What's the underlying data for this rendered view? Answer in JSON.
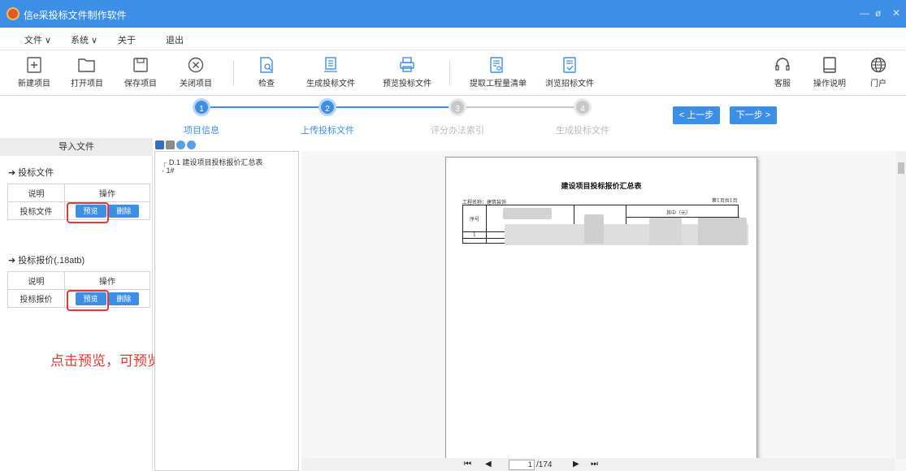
{
  "titlebar": {
    "title": "信e采投标文件制作软件",
    "minimize": "—",
    "restore": "ø",
    "close": "✕"
  },
  "menu": {
    "file": "文件 ∨",
    "system": "系统 ∨",
    "about": "关于",
    "exit": "退出"
  },
  "toolbar": {
    "new": "新建项目",
    "open": "打开项目",
    "save": "保存项目",
    "close": "关闭项目",
    "check": "检查",
    "generate": "生成投标文件",
    "preview": "预览投标文件",
    "extract": "提取工程量清单",
    "browse": "浏览招标文件",
    "service": "客服",
    "manual": "操作说明",
    "portal": "门户"
  },
  "steps": {
    "s1": {
      "num": "1",
      "label": "项目信息"
    },
    "s2": {
      "num": "2",
      "label": "上传投标文件"
    },
    "s3": {
      "num": "3",
      "label": "评分办法索引"
    },
    "s4": {
      "num": "4",
      "label": "生成投标文件"
    },
    "prev": "< 上一步",
    "next": "下一步 >"
  },
  "left": {
    "header": "导入文件",
    "sec1": "➜ 投标文件",
    "sec2": "➜ 投标报价(.18atb)",
    "col_desc": "说明",
    "col_op": "操作",
    "row1": "投标文件",
    "row2": "投标报价",
    "preview_btn": "预览",
    "delete_btn": "删除",
    "hint": "点击预览，可预览对应的文件"
  },
  "tree": {
    "node1": "D.1  建设项目投标报价汇总表",
    "node2": "1#"
  },
  "doc": {
    "title": "建设项目投标报价汇总表",
    "project": "工程名称：建筑装饰",
    "page_info": "第1页共1页",
    "col_no": "序号",
    "col_of_which": "其中（元）",
    "row_no": "1"
  },
  "pager": {
    "first": "⏮",
    "prev": "◀",
    "current": "1",
    "total": "/174",
    "next": "▶",
    "last": "⏭"
  },
  "colors": {
    "accent": "#3d8fe6",
    "highlight": "#e33333",
    "step_inactive": "#c8c8c8"
  }
}
